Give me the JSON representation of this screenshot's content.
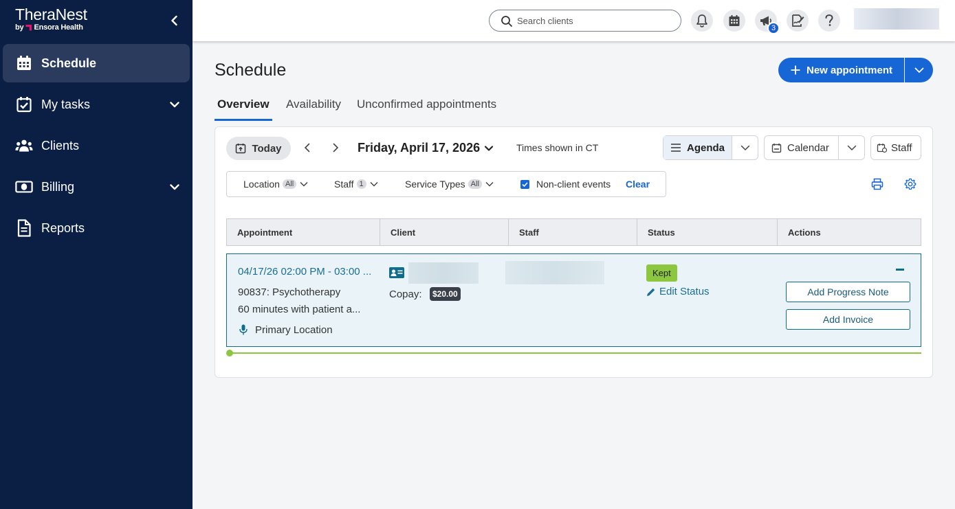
{
  "brand": {
    "name": "TheraNest",
    "sub_prefix": "by",
    "sub_company": "Ensora Health"
  },
  "sidebar": {
    "items": [
      {
        "label": "Schedule",
        "icon": "calendar-icon",
        "active": true
      },
      {
        "label": "My tasks",
        "icon": "task-check-icon",
        "expandable": true
      },
      {
        "label": "Clients",
        "icon": "people-icon"
      },
      {
        "label": "Billing",
        "icon": "money-icon",
        "expandable": true
      },
      {
        "label": "Reports",
        "icon": "document-icon"
      }
    ]
  },
  "topbar": {
    "search_placeholder": "Search clients",
    "notification_badge": "3"
  },
  "page": {
    "title": "Schedule",
    "new_appointment_label": "New appointment"
  },
  "tabs": [
    {
      "label": "Overview",
      "active": true
    },
    {
      "label": "Availability"
    },
    {
      "label": "Unconfirmed appointments"
    }
  ],
  "toolbar": {
    "today_label": "Today",
    "date_title": "Friday, April 17, 2026",
    "timezone_text": "Times shown in CT",
    "agenda_label": "Agenda",
    "calendar_label": "Calendar",
    "staff_label": "Staff"
  },
  "filters": {
    "location_label": "Location",
    "location_value": "All",
    "staff_label": "Staff",
    "staff_value": "1",
    "service_types_label": "Service Types",
    "service_types_value": "All",
    "non_client_events_label": "Non-client events",
    "non_client_events_checked": true,
    "clear_label": "Clear"
  },
  "table": {
    "columns": [
      "Appointment",
      "Client",
      "Staff",
      "Status",
      "Actions"
    ]
  },
  "appointment": {
    "time_range": "04/17/26 02:00 PM - 03:00 ...",
    "service": "90837: Psychotherapy",
    "description": "60 minutes with patient a...",
    "location": "Primary Location",
    "copay_label": "Copay:",
    "copay_amount": "$20.00",
    "status": "Kept",
    "edit_status_label": "Edit Status",
    "add_progress_note_label": "Add Progress Note",
    "add_invoice_label": "Add Invoice"
  },
  "colors": {
    "sidebar_bg": "#0b1f45",
    "accent": "#1766d6",
    "kept_green": "#8dc63f",
    "appt_teal": "#0e6d8c"
  }
}
